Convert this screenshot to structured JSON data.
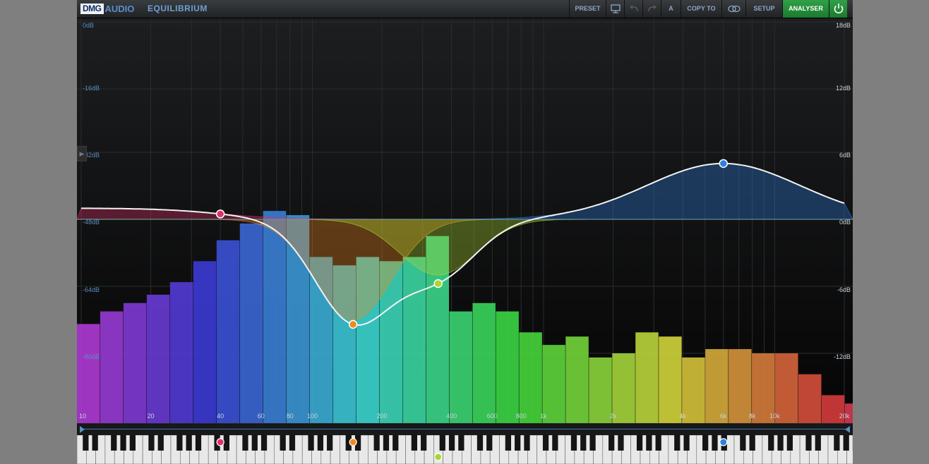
{
  "app": {
    "brand_dmg": "DMG",
    "brand_audio": "AUDIO",
    "product": "EQUILIBRIUM"
  },
  "toolbar": {
    "preset": "PRESET",
    "ab": "A",
    "copy_to": "COPY TO",
    "setup": "SETUP",
    "analyser": "ANALYSER",
    "accent_color": "#27913e"
  },
  "left_db_labels": [
    "0dB",
    "-16dB",
    "-32dB",
    "-48dB",
    "-64dB",
    "-80dB"
  ],
  "right_db_labels": [
    "18dB",
    "12dB",
    "6dB",
    "0dB",
    "-6dB",
    "-12dB"
  ],
  "freq_labels": [
    "10",
    "20",
    "40",
    "60",
    "80",
    "100",
    "200",
    "400",
    "600",
    "800",
    "1k",
    "2k",
    "4k",
    "6k",
    "8k",
    "10k",
    "20k"
  ],
  "chart_data": {
    "type": "bar",
    "x_scale": "log",
    "x_range": [
      10,
      20000
    ],
    "spectrum_left_axis_range_db": [
      -96,
      0
    ],
    "eq_right_axis_range_db": [
      -18,
      18
    ],
    "spectrum_level_db": [
      -73,
      -70,
      -68,
      -66,
      -63,
      -58,
      -53,
      -49,
      -46,
      -47,
      -57,
      -59,
      -57,
      -58,
      -57,
      -52,
      -70,
      -68,
      -70,
      -75,
      -78,
      -76,
      -81,
      -80,
      -75,
      -76,
      -81,
      -79,
      -79,
      -80,
      -80,
      -85,
      -90,
      -92
    ],
    "eq_bands": [
      {
        "freq_hz": 40,
        "gain_db": 1,
        "color": "#e0306a"
      },
      {
        "freq_hz": 150,
        "gain_db": -9,
        "color": "#f08a20"
      },
      {
        "freq_hz": 350,
        "gain_db": -5,
        "color": "#a8d830"
      },
      {
        "freq_hz": 6000,
        "gain_db": 5,
        "color": "#2f7fe0"
      }
    ]
  }
}
